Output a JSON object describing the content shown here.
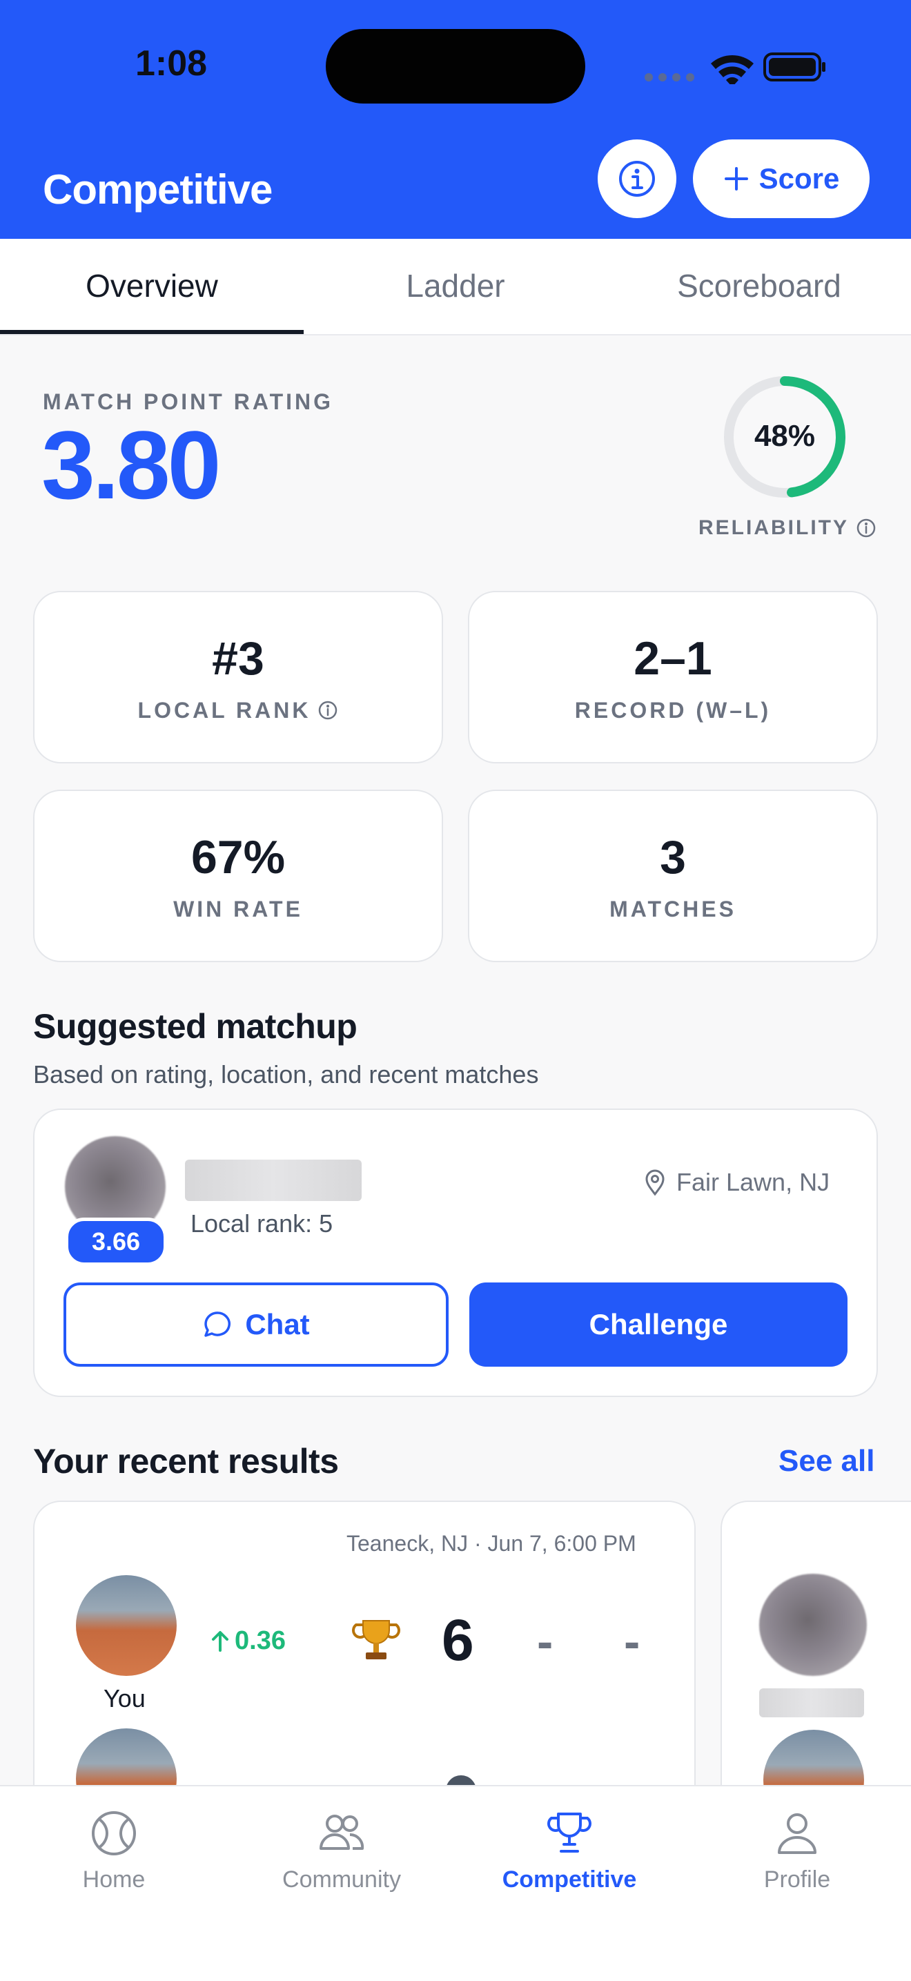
{
  "status_bar": {
    "time": "1:08"
  },
  "header": {
    "title": "Competitive",
    "info_icon": "info-circle-icon",
    "score_button_label": "Score",
    "score_button_icon": "plus-icon",
    "background_color": "#2359f9"
  },
  "tabs": [
    {
      "label": "Overview",
      "active": true
    },
    {
      "label": "Ladder",
      "active": false
    },
    {
      "label": "Scoreboard",
      "active": false
    }
  ],
  "rating": {
    "label": "MATCH POINT RATING",
    "value": "3.80",
    "reliability_value": "48%",
    "reliability_fraction": 0.48,
    "reliability_label": "RELIABILITY",
    "ring_color": "#1db97a"
  },
  "stats": [
    {
      "value": "#3",
      "label": "LOCAL RANK",
      "has_info": true
    },
    {
      "value": "2–1",
      "label": "RECORD (W–L)",
      "has_info": false
    },
    {
      "value": "67%",
      "label": "WIN RATE",
      "has_info": false
    },
    {
      "value": "3",
      "label": "MATCHES",
      "has_info": false
    }
  ],
  "suggested": {
    "title": "Suggested matchup",
    "subtitle": "Based on rating, location, and recent matches",
    "player_rating": "3.66",
    "local_rank": "Local rank: 5",
    "location": "Fair Lawn, NJ",
    "chat_label": "Chat",
    "challenge_label": "Challenge"
  },
  "recent": {
    "title": "Your recent results",
    "see_all": "See all",
    "card": {
      "meta": "Teaneck, NJ · Jun 7, 6:00 PM",
      "player_name": "You",
      "rating_change": "0.36",
      "score": "6",
      "dash1": "-",
      "dash2": "-"
    }
  },
  "bottom_nav": [
    {
      "label": "Home",
      "icon": "tennis-ball-icon",
      "active": false
    },
    {
      "label": "Community",
      "icon": "people-icon",
      "active": false
    },
    {
      "label": "Competitive",
      "icon": "trophy-icon",
      "active": true
    },
    {
      "label": "Profile",
      "icon": "person-icon",
      "active": false
    }
  ]
}
